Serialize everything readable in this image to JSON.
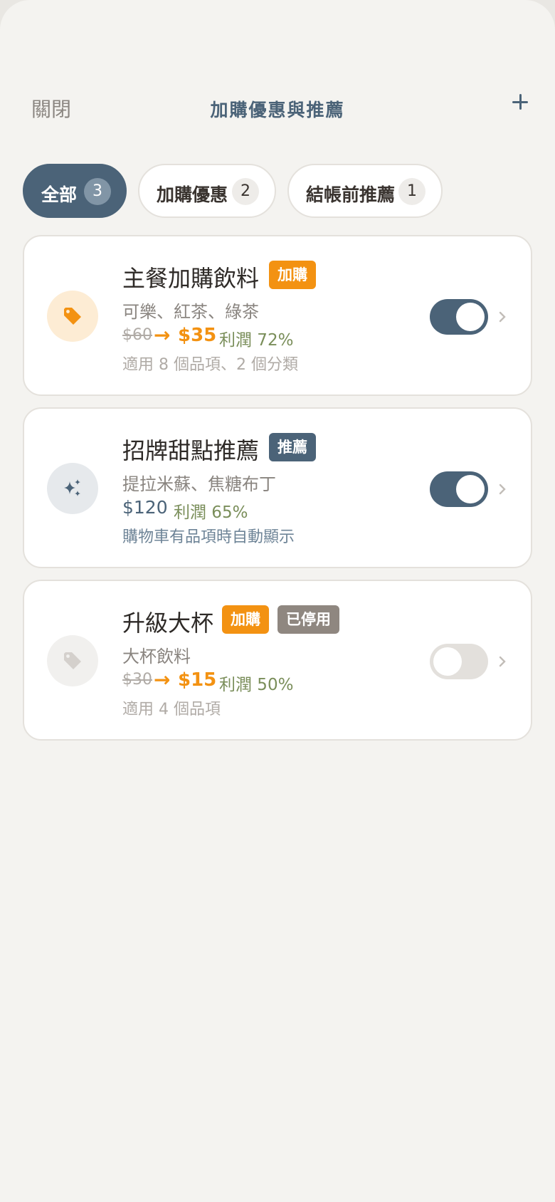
{
  "header": {
    "close_label": "關閉",
    "title": "加購優惠與推薦",
    "add_icon": "plus-icon"
  },
  "filters": [
    {
      "label": "全部",
      "count": "3",
      "active": true
    },
    {
      "label": "加購優惠",
      "count": "2",
      "active": false
    },
    {
      "label": "結帳前推薦",
      "count": "1",
      "active": false
    }
  ],
  "cards": [
    {
      "icon": "tag-icon",
      "title": "主餐加購飲料",
      "badges": [
        "加購"
      ],
      "subtitle": "可樂、紅茶、綠茶",
      "original_price": "$60",
      "arrow": "→",
      "price": "$35",
      "profit": "利潤 72%",
      "note": "適用 8 個品項、2 個分類",
      "enabled": true
    },
    {
      "icon": "sparkles-icon",
      "title": "招牌甜點推薦",
      "badges": [
        "推薦"
      ],
      "subtitle": "提拉米蘇、焦糖布丁",
      "price": "$120",
      "profit": "利潤 65%",
      "note": "購物車有品項時自動顯示",
      "enabled": true
    },
    {
      "icon": "tag-icon",
      "title": "升級大杯",
      "badges": [
        "加購",
        "已停用"
      ],
      "subtitle": "大杯飲料",
      "original_price": "$30",
      "arrow": "→",
      "price": "$15",
      "profit": "利潤 50%",
      "note": "適用 4 個品項",
      "enabled": false
    }
  ],
  "colors": {
    "primary": "#4b6378",
    "accent": "#f39212",
    "profit": "#7a8e5a",
    "disabled_badge": "#8f8780",
    "background": "#f4f3f0"
  }
}
